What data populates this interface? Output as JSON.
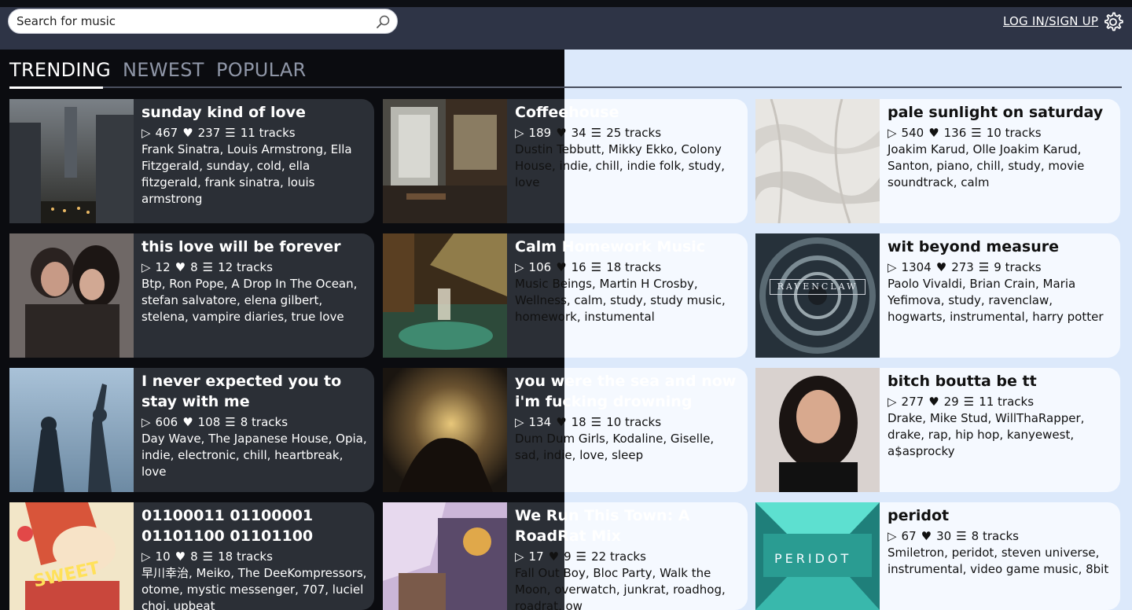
{
  "search": {
    "placeholder": "Search for music"
  },
  "header": {
    "login_label": "LOG IN/SIGN UP"
  },
  "tabs": [
    {
      "label": "TRENDING",
      "active": true
    },
    {
      "label": "NEWEST",
      "active": false
    },
    {
      "label": "POPULAR",
      "active": false
    }
  ],
  "playlists": [
    {
      "title": "sunday kind of love",
      "plays": "467",
      "likes": "237",
      "tracks": "11 tracks",
      "tags": "Frank Sinatra, Louis Armstrong, Ella Fitzgerald, sunday, cold, ella fitzgerald, frank sinatra, louis armstrong"
    },
    {
      "title": "Coffeehouse",
      "plays": "189",
      "likes": "34",
      "tracks": "25 tracks",
      "tags": "Dustin Tebbutt, Mikky Ekko, Colony House, indie, chill, indie folk, study, love"
    },
    {
      "title": "pale sunlight on saturday",
      "plays": "540",
      "likes": "136",
      "tracks": "10 tracks",
      "tags": "Joakim Karud, Olle Joakim Karud, Santon, piano, chill, study, movie soundtrack, calm"
    },
    {
      "title": "this love will be forever",
      "plays": "12",
      "likes": "8",
      "tracks": "12 tracks",
      "tags": "Btp, Ron Pope, A Drop In The Ocean, stefan salvatore, elena gilbert, stelena, vampire diaries, true love"
    },
    {
      "title": "Calm Homework Music",
      "plays": "106",
      "likes": "16",
      "tracks": "18 tracks",
      "tags": "Music Beings, Martin H Crosby, Wellness, calm, study, study music, homework, instumental"
    },
    {
      "title": "wit beyond measure",
      "plays": "1304",
      "likes": "273",
      "tracks": "9 tracks",
      "tags": "Paolo Vivaldi, Brian Crain, Maria Yefimova, study, ravenclaw, hogwarts, instrumental, harry potter"
    },
    {
      "title": "I never expected you to stay with me",
      "plays": "606",
      "likes": "108",
      "tracks": "8 tracks",
      "tags": "Day Wave, The Japanese House, Opia, indie, electronic, chill, heartbreak, love"
    },
    {
      "title": "you were the sea and now i'm fucking drowning",
      "plays": "134",
      "likes": "18",
      "tracks": "10 tracks",
      "tags": "Dum Dum Girls, Kodaline, Giselle, sad, indie, love, sleep"
    },
    {
      "title": "bitch boutta be tt",
      "plays": "277",
      "likes": "29",
      "tracks": "11 tracks",
      "tags": "Drake, Mike Stud, WillThaRapper, drake, rap, hip hop, kanyewest, a$asprocky"
    },
    {
      "title": "01100011 01100001 01101100 01101100",
      "plays": "10",
      "likes": "8",
      "tracks": "18 tracks",
      "tags": "早川幸治, Meiko, The DeeKompressors, otome, mystic messenger, 707, luciel choi, upbeat"
    },
    {
      "title": "We Run This Town: A RoadRat Mix",
      "plays": "17",
      "likes": "9",
      "tracks": "22 tracks",
      "tags": "Fall Out Boy, Bloc Party, Walk the Moon, overwatch, junkrat, roadhog, roadrat, ow"
    },
    {
      "title": "peridot",
      "plays": "67",
      "likes": "30",
      "tracks": "8 tracks",
      "tags": "Smiletron, peridot, steven universe, instrumental, video game music, 8bit"
    }
  ],
  "art_text": {
    "ravenclaw": "RAVENCLAW",
    "peridot": "PERIDOT",
    "sweet": "SWEET"
  },
  "colors": {
    "header": "#2e3446",
    "dark_card": "#2b2f36",
    "light_card": "#f5f9ff",
    "light_bg": "#dce9fb",
    "dark_bg": "#0b0c10"
  }
}
